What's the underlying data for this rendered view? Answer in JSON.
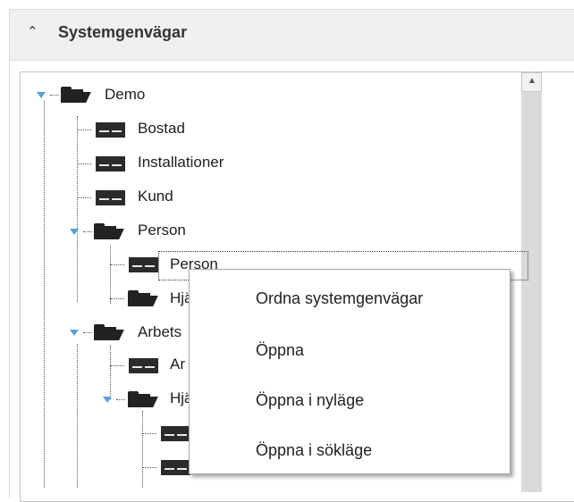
{
  "panel": {
    "title": "Systemgenvägar",
    "collapse_icon": "chevron-up-icon"
  },
  "tree": {
    "items": [
      {
        "label": "Demo",
        "icon": "folder-icon",
        "expanded": true
      },
      {
        "label": "Bostad",
        "icon": "shortcut-icon"
      },
      {
        "label": "Installationer",
        "icon": "shortcut-icon"
      },
      {
        "label": "Kund",
        "icon": "shortcut-icon"
      },
      {
        "label": "Person",
        "icon": "folder-icon",
        "expanded": true
      },
      {
        "label": "Person",
        "icon": "shortcut-icon",
        "selected": true
      },
      {
        "label": "Hjä",
        "icon": "folder-icon"
      },
      {
        "label": "Arbets",
        "icon": "folder-icon",
        "expanded": true
      },
      {
        "label": "Ar",
        "icon": "shortcut-icon"
      },
      {
        "label": "Hjä",
        "icon": "folder-icon",
        "expanded": true
      },
      {
        "label": "",
        "icon": "shortcut-icon"
      },
      {
        "label": "",
        "icon": "shortcut-icon"
      }
    ]
  },
  "context_menu": {
    "items": [
      {
        "label": "Ordna systemgenvägar"
      },
      {
        "label": "Öppna"
      },
      {
        "label": "Öppna i nyläge"
      },
      {
        "label": "Öppna i sökläge"
      }
    ]
  },
  "colors": {
    "expand_arrow": "#5aa0d8",
    "header_bg": "#f0f0f0",
    "scrollbar": "#dadada"
  }
}
